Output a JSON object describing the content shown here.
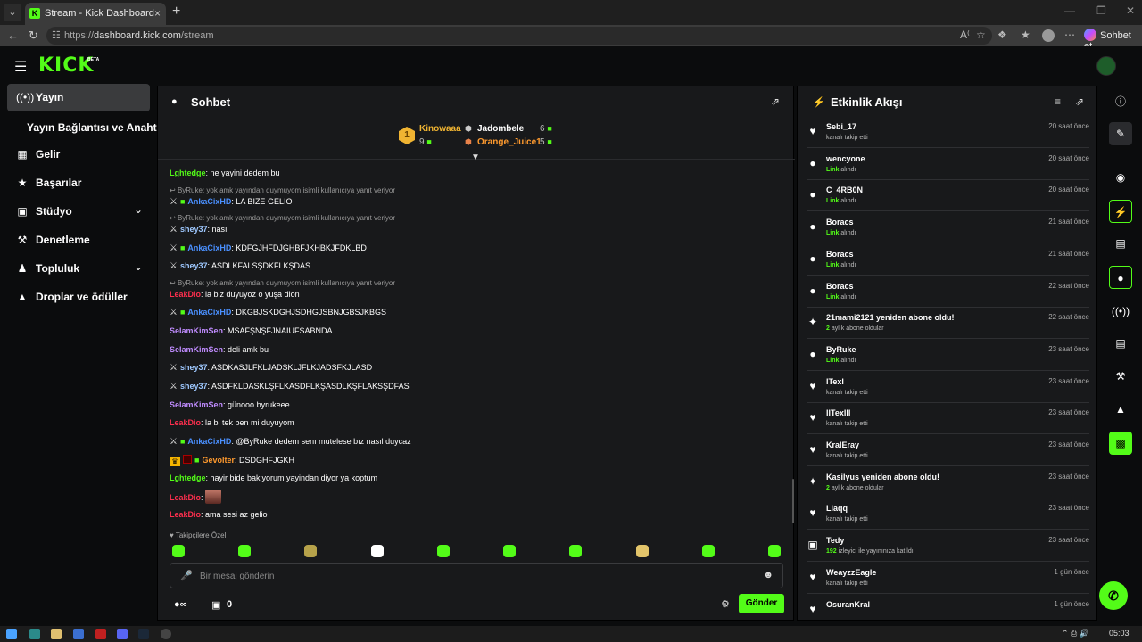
{
  "browser": {
    "tab_title": "Stream - Kick Dashboard",
    "url_prefix": "https://",
    "url_host": "dashboard.kick.com",
    "url_path": "/stream",
    "copilot_label": "Sohbet et"
  },
  "app": {
    "logo": "KICK",
    "logo_badge": "BETA"
  },
  "sidebar": {
    "items": [
      {
        "label": "Yayın",
        "icon": "broadcast-icon"
      },
      {
        "label": "Yayın Bağlantısı ve Anahtarı"
      },
      {
        "label": "Gelir",
        "icon": "chart-icon"
      },
      {
        "label": "Başarılar",
        "icon": "trophy-icon"
      },
      {
        "label": "Stüdyo",
        "icon": "studio-icon"
      },
      {
        "label": "Denetleme",
        "icon": "wrench-icon"
      },
      {
        "label": "Topluluk",
        "icon": "community-icon"
      },
      {
        "label": "Droplar ve ödüller",
        "icon": "drops-icon"
      }
    ]
  },
  "chat": {
    "title": "Sohbet",
    "leaderboard": {
      "rank": "1",
      "first": {
        "name": "Kinowaaa",
        "count": "9"
      },
      "second": {
        "name": "Jadombele",
        "count": "6"
      },
      "third": {
        "name": "Orange_Juice1",
        "count": "5"
      }
    },
    "messages": [
      {
        "user": "Lghtedge",
        "color": "#53fc18",
        "text": ": ne yayini dedem bu"
      },
      {
        "reply": "ByRuke: yok amk yayından duymuyom isimli kullanıcıya yanıt veriyor"
      },
      {
        "user": "AnkaCixHD",
        "color": "#4a90ff",
        "text": ": LA BIZE GELIO"
      },
      {
        "reply": "ByRuke: yok amk yayından duymuyom isimli kullanıcıya yanıt veriyor"
      },
      {
        "user": "shey37",
        "color": "#9ec8ff",
        "text": ": nasıl"
      },
      {
        "user": "AnkaCixHD",
        "color": "#4a90ff",
        "text": ": KDFGJHFDJGHBFJKHBKJFDKLBD"
      },
      {
        "user": "shey37",
        "color": "#9ec8ff",
        "text": ": ASDLKFALSŞDKFLKŞDAS"
      },
      {
        "reply": "ByRuke: yok amk yayından duymuyom isimli kullanıcıya yanıt veriyor"
      },
      {
        "user": "LeakDio",
        "color": "#ff2f4e",
        "text": ": la biz duyuyoz o yuşa dion"
      },
      {
        "user": "AnkaCixHD",
        "color": "#4a90ff",
        "text": ": DKGBJSKDGHJSDHGJSBNJGBSJKBGS"
      },
      {
        "user": "SelamKimSen",
        "color": "#c08cff",
        "text": ": MSAFŞNŞFJNAIUFSABNDA"
      },
      {
        "user": "SelamKimSen",
        "color": "#c08cff",
        "text": ": deli amk bu"
      },
      {
        "user": "shey37",
        "color": "#9ec8ff",
        "text": ": ASDKASJLFKLJADSKLJFLKJADSFKJLASD"
      },
      {
        "user": "shey37",
        "color": "#9ec8ff",
        "text": ": ASDFKLDASKLŞFLKASDFLKŞASDLKŞFLAKSŞDFAS"
      },
      {
        "user": "SelamKimSen",
        "color": "#c08cff",
        "text": ": günooo byrukeee"
      },
      {
        "user": "LeakDio",
        "color": "#ff2f4e",
        "text": ": la bi tek ben mi duyuyom"
      },
      {
        "user": "AnkaCixHD",
        "color": "#4a90ff",
        "text": ": @ByRuke dedem senı mutelese bız nasıl duycaz"
      },
      {
        "user": "Gevolter",
        "color": "#ff9a2e",
        "text": ": DSDGHFJGKH"
      },
      {
        "user": "Lghtedge",
        "color": "#53fc18",
        "text": ": hayir bide bakiyorum yayindan diyor ya koptum"
      },
      {
        "user": "LeakDio",
        "color": "#ff2f4e",
        "text": ":"
      },
      {
        "user": "LeakDio",
        "color": "#ff2f4e",
        "text": ": ama sesi az gelio"
      }
    ],
    "followers_only": "Takipçilere Özel",
    "input_placeholder": "Bir mesaj gönderin",
    "points": "0",
    "send_label": "Gönder"
  },
  "activity": {
    "title": "Etkinlik Akışı",
    "items": [
      {
        "name": "Sebi_17",
        "sub_hl": "",
        "sub": "kanalı takip etti",
        "time": "20 saat önce",
        "icon": "heart-icon"
      },
      {
        "name": "wencyone",
        "sub_hl": "Link",
        "sub": " alındı",
        "time": "20 saat önce",
        "icon": "drops-icon"
      },
      {
        "name": "C_4RB0N",
        "sub_hl": "Link",
        "sub": " alındı",
        "time": "20 saat önce",
        "icon": "drops-icon"
      },
      {
        "name": "Boracs",
        "sub_hl": "Link",
        "sub": " alındı",
        "time": "21 saat önce",
        "icon": "drops-icon"
      },
      {
        "name": "Boracs",
        "sub_hl": "Link",
        "sub": " alındı",
        "time": "21 saat önce",
        "icon": "drops-icon"
      },
      {
        "name": "Boracs",
        "sub_hl": "Link",
        "sub": " alındı",
        "time": "22 saat önce",
        "icon": "drops-icon"
      },
      {
        "name": "21mami2121 yeniden abone oldu!",
        "sub_hl": "2",
        "sub": " aylık abone oldular",
        "time": "22 saat önce",
        "icon": "sparkle-icon"
      },
      {
        "name": "ByRuke",
        "sub_hl": "Link",
        "sub": " alındı",
        "time": "23 saat önce",
        "icon": "drops-icon"
      },
      {
        "name": "lTexl",
        "sub_hl": "",
        "sub": "kanalı takip etti",
        "time": "23 saat önce",
        "icon": "heart-icon"
      },
      {
        "name": "llTexlll",
        "sub_hl": "",
        "sub": "kanalı takip etti",
        "time": "23 saat önce",
        "icon": "heart-icon"
      },
      {
        "name": "KralEray",
        "sub_hl": "",
        "sub": "kanalı takip etti",
        "time": "23 saat önce",
        "icon": "heart-icon"
      },
      {
        "name": "Kasilyus yeniden abone oldu!",
        "sub_hl": "2",
        "sub": " aylık abone oldular",
        "time": "23 saat önce",
        "icon": "sparkle-icon"
      },
      {
        "name": "Liaqq",
        "sub_hl": "",
        "sub": "kanalı takip etti",
        "time": "23 saat önce",
        "icon": "heart-icon"
      },
      {
        "name": "Tedy",
        "sub_hl": "192",
        "sub": " izleyici ile yayınınıza katıldı!",
        "time": "23 saat önce",
        "icon": "raid-icon"
      },
      {
        "name": "WeayzzEagle",
        "sub_hl": "",
        "sub": "kanalı takip etti",
        "time": "1 gün önce",
        "icon": "heart-icon"
      },
      {
        "name": "OsuranKral",
        "sub_hl": "",
        "sub": "",
        "time": "1 gün önce",
        "icon": "heart-icon"
      }
    ]
  },
  "taskbar": {
    "time": "05:03"
  },
  "colors": {
    "accent": "#53fc18",
    "panel": "#18191b",
    "background": "#0b0c0d"
  }
}
